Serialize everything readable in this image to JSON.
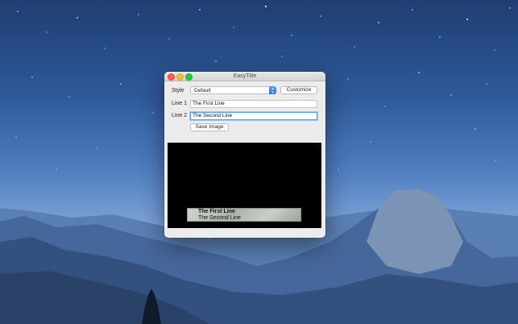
{
  "window": {
    "title": "EasyTitle"
  },
  "form": {
    "style_label": "Style",
    "style_value": "Default",
    "customize_label": "Customize",
    "line1_label": "Line 1",
    "line1_value": "The First Line",
    "line2_label": "Line 2",
    "line2_value": "The Second Line",
    "save_label": "Save Image"
  },
  "preview": {
    "caption_line1": "The First Line",
    "caption_line2": "The Second Line"
  },
  "colors": {
    "close": "#fc5f57",
    "minimize": "#fdbc2e",
    "maximize": "#2ac842",
    "accent": "#2a72e6"
  }
}
